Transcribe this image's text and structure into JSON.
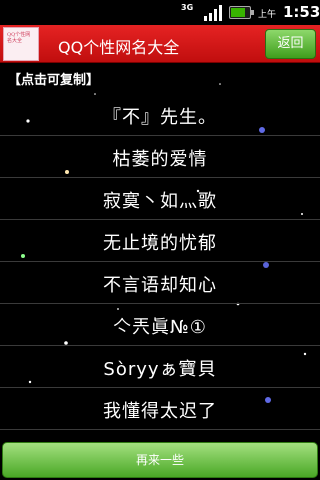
{
  "status_bar": {
    "network": "3G",
    "ampm": "上午",
    "time": "1:53",
    "battery_level": 0.8
  },
  "title_bar": {
    "app_icon_text": "QQ个性网名大全",
    "title": "QQ个性网名大全",
    "back_label": "返回"
  },
  "content": {
    "hint": "【点击可复制】",
    "names": [
      "『不』先生。",
      "枯萎的爱情",
      "寂寞丶如灬歌",
      "无止境的忧郁",
      "不言语却知心",
      "亽兲眞№①",
      "Sòryyぁ寶貝",
      "我懂得太迟了"
    ]
  },
  "footer": {
    "more_label": "再来一些"
  },
  "colors": {
    "title_bar": "#d41818",
    "button_green": "#5ab833",
    "background": "#000000"
  }
}
